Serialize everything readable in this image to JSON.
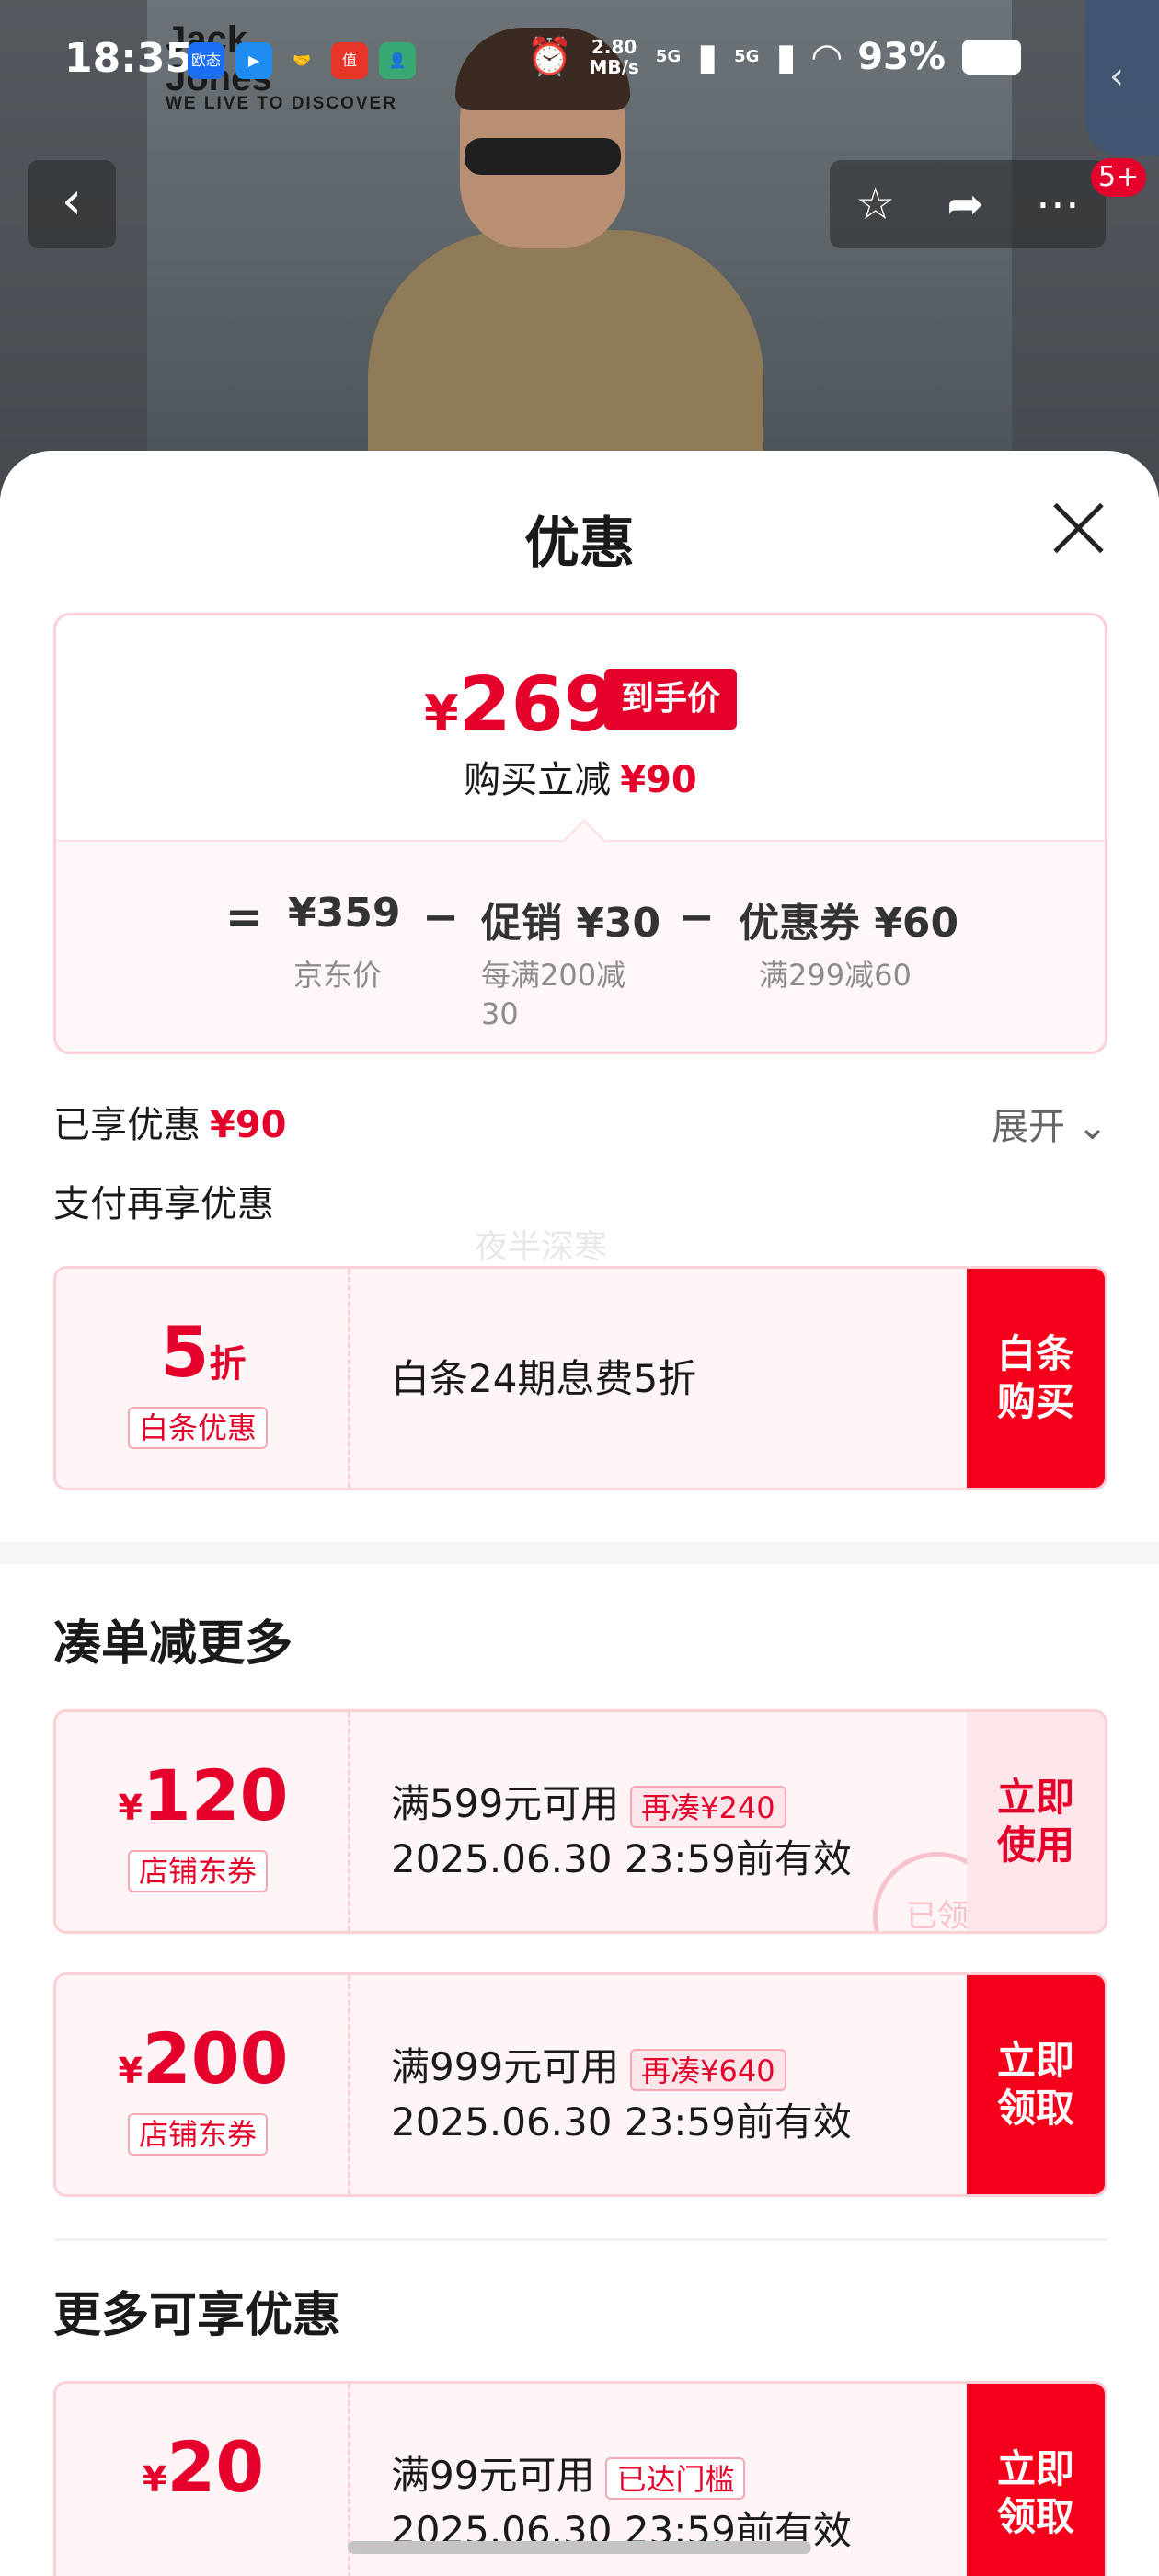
{
  "status_bar": {
    "time": "18:35",
    "network_speed": "2.80",
    "network_unit": "MB/s",
    "signal_1": "5G",
    "signal_2": "5G",
    "battery": "93%",
    "app_icons": [
      "欧态",
      "▶",
      "🤝",
      "值",
      "👤"
    ]
  },
  "product_image": {
    "brand_logo_line1": "Jack",
    "brand_logo_line2": "Jones",
    "brand_tagline": "WE LIVE TO DISCOVER"
  },
  "top_nav": {
    "badge": "5+"
  },
  "sheet": {
    "title": "优惠",
    "final_price": {
      "currency": "¥",
      "value": "269",
      "tag": "到手价",
      "reduction_label": "购买立减",
      "reduction_amount": "¥90"
    },
    "formula": {
      "equals": "=",
      "jd_price": "¥359",
      "jd_price_label": "京东价",
      "minus": "−",
      "promo": "促销 ¥30",
      "promo_detail_1": "每满200减",
      "promo_detail_2": "30",
      "coupon": "优惠券 ¥60",
      "coupon_detail": "满299减60"
    },
    "enjoyed_label": "已享优惠",
    "enjoyed_amount": "¥90",
    "expand_label": "展开 ⌄",
    "pay_more_label": "支付再享优惠",
    "watermark": "夜半深寒"
  },
  "baitiao": {
    "amount_big": "5",
    "amount_unit": "折",
    "kind": "白条优惠",
    "description": "白条24期息费5折",
    "action": "白条购买"
  },
  "section_more_savings": {
    "title": "凑单减更多",
    "coupons": [
      {
        "currency": "¥",
        "amount": "120",
        "kind": "店铺东券",
        "condition": "满599元可用",
        "pill": "再凑¥240",
        "validity": "2025.06.30 23:59前有效",
        "action": "立即使用",
        "stamp": "已领"
      },
      {
        "currency": "¥",
        "amount": "200",
        "kind": "店铺东券",
        "condition": "满999元可用",
        "pill": "再凑¥640",
        "validity": "2025.06.30 23:59前有效",
        "action": "立即领取"
      }
    ]
  },
  "section_more_offers": {
    "title": "更多可享优惠",
    "coupons": [
      {
        "currency": "¥",
        "amount": "20",
        "condition": "满99元可用",
        "pill": "已达门槛",
        "validity": "2025.06.30 23:59前有效",
        "action": "立即领取"
      }
    ]
  },
  "colors": {
    "accent_red": "#e4002b",
    "action_red": "#f5001b",
    "coupon_bg": "#fff4f6",
    "border_pink": "#fcd0d6"
  }
}
